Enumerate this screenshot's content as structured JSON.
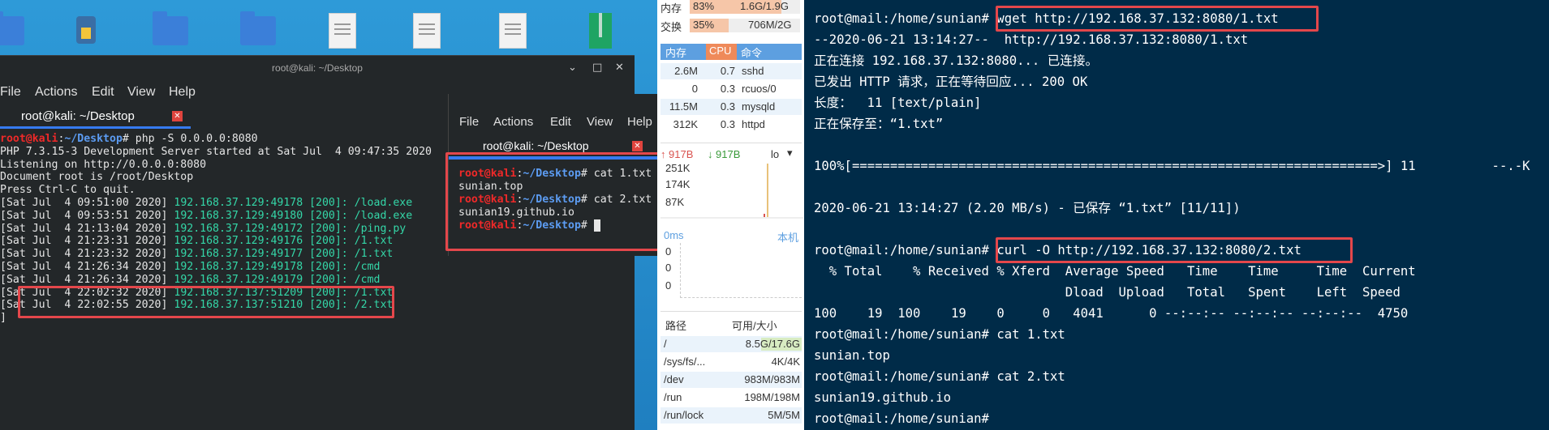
{
  "desktop": {
    "icons": [
      "python-file-icon",
      "folder-icon",
      "folder-icon",
      "document-icon",
      "document-icon",
      "document-icon",
      "archive-icon"
    ]
  },
  "term1": {
    "title": "root@kali: ~/Desktop",
    "menu": [
      "File",
      "Actions",
      "Edit",
      "View",
      "Help"
    ],
    "tab_label": "root@kali: ~/Desktop",
    "lines": [
      {
        "prompt_user": "root@kali",
        "sep": ":",
        "path": "~/Desktop",
        "cmd": "# php -S 0.0.0.0:8080"
      },
      {
        "text": "PHP 7.3.15-3 Development Server started at Sat Jul  4 09:47:35 2020"
      },
      {
        "text": "Listening on http://0.0.0.0:8080"
      },
      {
        "text": "Document root is /root/Desktop"
      },
      {
        "text": "Press Ctrl-C to quit."
      },
      {
        "date": "[Sat Jul  4 09:51:00 2020] ",
        "ip": "192.168.37.129:49178 [200]: /load.exe"
      },
      {
        "date": "[Sat Jul  4 09:53:51 2020] ",
        "ip": "192.168.37.129:49180 [200]: /load.exe"
      },
      {
        "date": "[Sat Jul  4 21:13:04 2020] ",
        "ip": "192.168.37.129:49172 [200]: /ping.py"
      },
      {
        "date": "[Sat Jul  4 21:23:31 2020] ",
        "ip": "192.168.37.129:49176 [200]: /1.txt"
      },
      {
        "date": "[Sat Jul  4 21:23:32 2020] ",
        "ip": "192.168.37.129:49177 [200]: /1.txt"
      },
      {
        "date": "[Sat Jul  4 21:26:34 2020] ",
        "ip": "192.168.37.129:49178 [200]: /cmd"
      },
      {
        "date": "[Sat Jul  4 21:26:34 2020] ",
        "ip": "192.168.37.129:49179 [200]: /cmd"
      },
      {
        "date": "[Sat Jul  4 22:02:32 2020] ",
        "ip": "192.168.37.137:51209 [200]: /1.txt"
      },
      {
        "date": "[Sat Jul  4 22:02:55 2020] ",
        "ip": "192.168.37.137:51210 [200]: /2.txt"
      },
      {
        "text": "]"
      }
    ]
  },
  "term2": {
    "menu": [
      "File",
      "Actions",
      "Edit",
      "View",
      "Help"
    ],
    "tab_label": "root@kali: ~/Desktop",
    "lines": [
      {
        "prompt_user": "root@kali",
        "sep": ":",
        "path": "~/Desktop",
        "cmd": "# cat 1.txt"
      },
      {
        "text": "sunian.top"
      },
      {
        "prompt_user": "root@kali",
        "sep": ":",
        "path": "~/Desktop",
        "cmd": "# cat 2.txt"
      },
      {
        "text": "sunian19.github.io"
      },
      {
        "prompt_user": "root@kali",
        "sep": ":",
        "path": "~/Desktop",
        "cmd": "# "
      }
    ]
  },
  "monitor": {
    "mem_label": "内存",
    "mem_pct": "83%",
    "mem_val": "1.6G/1.9G",
    "mem_fill": 0.83,
    "swap_label": "交换",
    "swap_pct": "35%",
    "swap_val": "706M/2G",
    "swap_fill": 0.35,
    "proc_headers": [
      "内存",
      "CPU",
      "命令"
    ],
    "procs": [
      {
        "mem": "2.6M",
        "cpu": "0.7",
        "cmd": "sshd"
      },
      {
        "mem": "0",
        "cpu": "0.3",
        "cmd": "rcuos/0"
      },
      {
        "mem": "11.5M",
        "cpu": "0.3",
        "cmd": "mysqld"
      },
      {
        "mem": "312K",
        "cpu": "0.3",
        "cmd": "httpd"
      }
    ],
    "net_up": "917B",
    "net_down": "917B",
    "net_iface": "lo",
    "net_scale": [
      "251K",
      "174K",
      "87K"
    ],
    "ping_label": "0ms",
    "ping_host": "本机",
    "ping_vals": [
      "0",
      "0",
      "0"
    ],
    "disk_headers": [
      "路径",
      "可用/大小"
    ],
    "disks": [
      {
        "path": "/",
        "val": "8.5G/17.6G"
      },
      {
        "path": "/sys/fs/...",
        "val": "4K/4K"
      },
      {
        "path": "/dev",
        "val": "983M/983M"
      },
      {
        "path": "/run",
        "val": "198M/198M"
      },
      {
        "path": "/run/lock",
        "val": "5M/5M"
      }
    ]
  },
  "rterm": {
    "lines": [
      "root@mail:/home/sunian# wget http://192.168.37.132:8080/1.txt",
      "--2020-06-21 13:14:27--  http://192.168.37.132:8080/1.txt",
      "正在连接 192.168.37.132:8080... 已连接。",
      "已发出 HTTP 请求，正在等待回应... 200 OK",
      "长度：  11 [text/plain]",
      "正在保存至：“1.txt”",
      "",
      "100%[=====================================================================>] 11          --.-K",
      "",
      "2020-06-21 13:14:27 (2.20 MB/s) - 已保存 “1.txt” [11/11])",
      "",
      "root@mail:/home/sunian# curl -O http://192.168.37.132:8080/2.txt",
      "  % Total    % Received % Xferd  Average Speed   Time    Time     Time  Current",
      "                                 Dload  Upload   Total   Spent    Left  Speed",
      "100    19  100    19    0     0   4041      0 --:--:-- --:--:-- --:--:--  4750",
      "root@mail:/home/sunian# cat 1.txt",
      "sunian.top",
      "root@mail:/home/sunian# cat 2.txt",
      "sunian19.github.io",
      "root@mail:/home/sunian# "
    ]
  },
  "colors": {
    "highlight": "#e4474b",
    "kali_red": "#ef2929",
    "kali_blue": "#5c9cf2",
    "log_green": "#34d7a8"
  }
}
